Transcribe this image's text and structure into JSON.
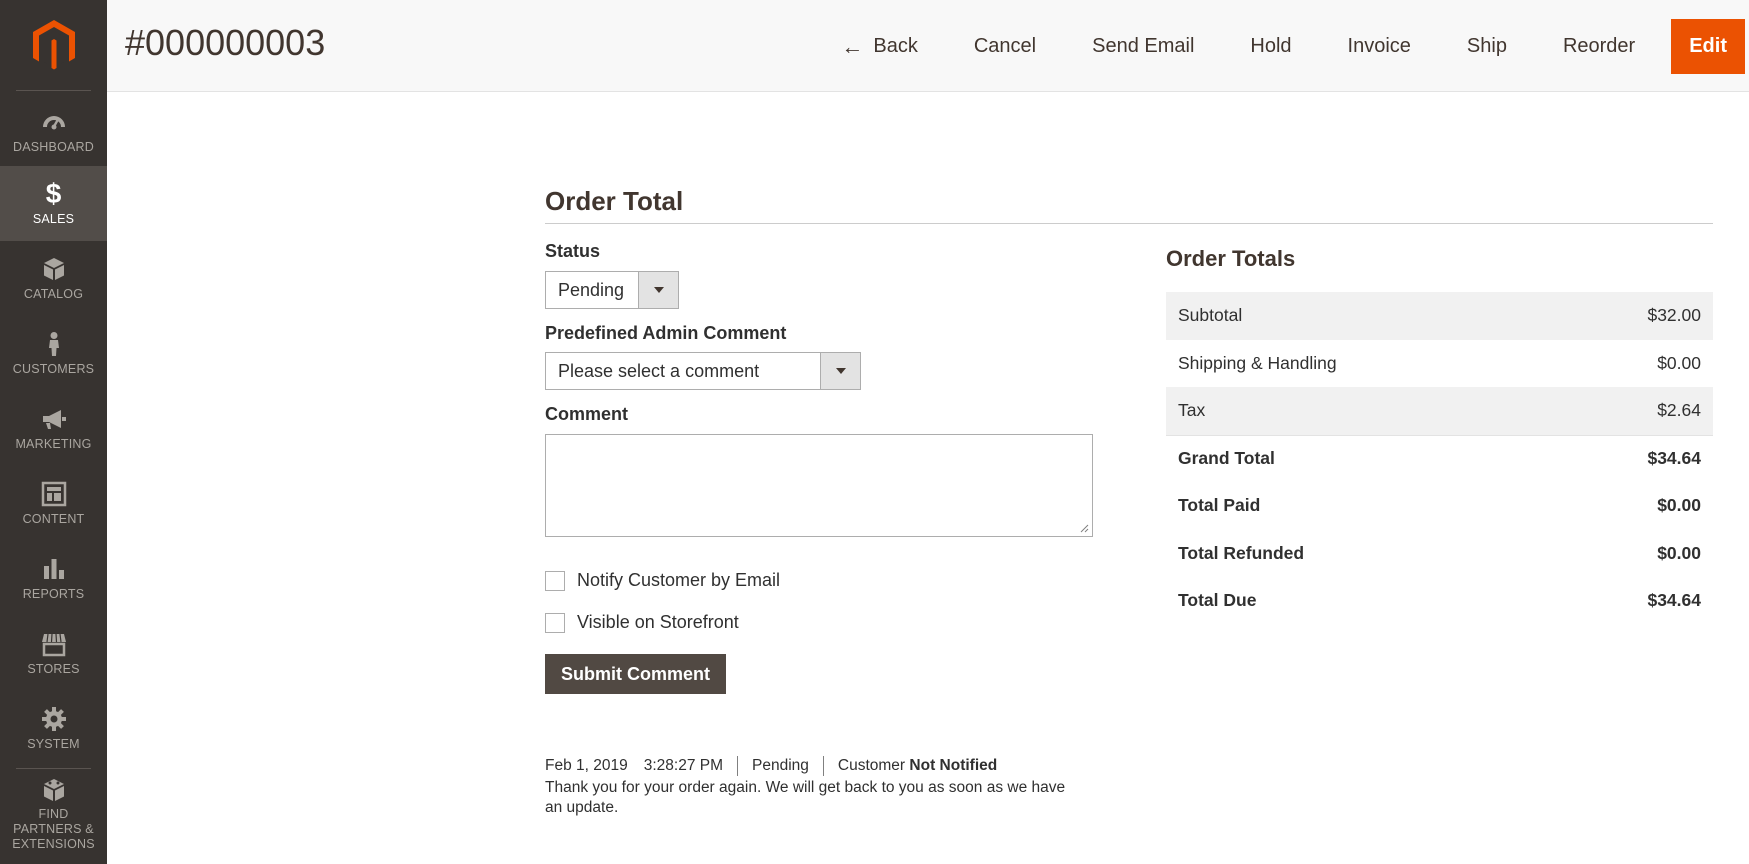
{
  "header": {
    "title": "#000000003",
    "actions": {
      "back": "Back",
      "cancel": "Cancel",
      "send_email": "Send Email",
      "hold": "Hold",
      "invoice": "Invoice",
      "ship": "Ship",
      "reorder": "Reorder",
      "edit": "Edit"
    }
  },
  "sidebar": {
    "items": [
      {
        "label": "DASHBOARD",
        "icon": "dashboard-icon"
      },
      {
        "label": "SALES",
        "icon": "dollar-icon"
      },
      {
        "label": "CATALOG",
        "icon": "box-icon"
      },
      {
        "label": "CUSTOMERS",
        "icon": "person-icon"
      },
      {
        "label": "MARKETING",
        "icon": "megaphone-icon"
      },
      {
        "label": "CONTENT",
        "icon": "layout-icon"
      },
      {
        "label": "REPORTS",
        "icon": "bar-chart-icon"
      },
      {
        "label": "STORES",
        "icon": "storefront-icon"
      },
      {
        "label": "SYSTEM",
        "icon": "gear-icon"
      },
      {
        "label": "FIND PARTNERS & EXTENSIONS",
        "icon": "blocks-icon"
      }
    ],
    "active_index": 1
  },
  "form": {
    "section_title": "Order Total",
    "status_label": "Status",
    "status_value": "Pending",
    "predefined_label": "Predefined Admin Comment",
    "predefined_value": "Please select a comment",
    "comment_label": "Comment",
    "comment_value": "",
    "notify_label": "Notify Customer by Email",
    "visible_label": "Visible on Storefront",
    "submit_label": "Submit Comment"
  },
  "history": {
    "date": "Feb 1, 2019",
    "time": "3:28:27 PM",
    "status": "Pending",
    "customer_prefix": "Customer",
    "customer_status": "Not Notified",
    "comment": "Thank you for your order again. We will get back to you as soon as we have an update."
  },
  "totals": {
    "title": "Order Totals",
    "rows": [
      {
        "label": "Subtotal",
        "value": "$32.00"
      },
      {
        "label": "Shipping & Handling",
        "value": "$0.00"
      },
      {
        "label": "Tax",
        "value": "$2.64"
      },
      {
        "label": "Grand Total",
        "value": "$34.64"
      },
      {
        "label": "Total Paid",
        "value": "$0.00"
      },
      {
        "label": "Total Refunded",
        "value": "$0.00"
      },
      {
        "label": "Total Due",
        "value": "$34.64"
      }
    ]
  },
  "colors": {
    "sidebar_bg": "#373330",
    "sidebar_active": "#524d49",
    "accent": "#eb5202",
    "submit_bg": "#514943"
  }
}
